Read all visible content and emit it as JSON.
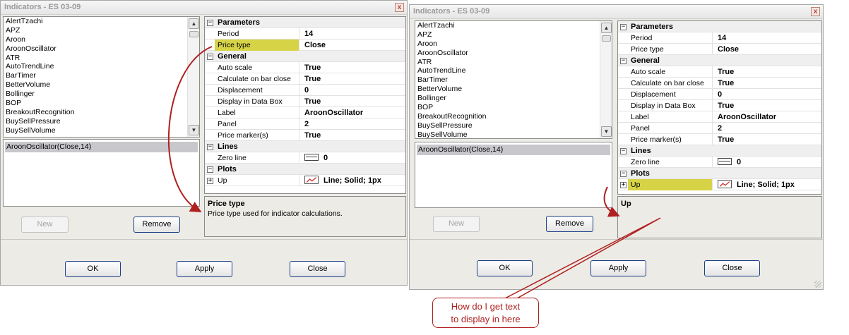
{
  "left": {
    "title": "Indicators - ES 03-09",
    "close_glyph": "x",
    "indicator_list": [
      "AlertTzachi",
      "APZ",
      "Aroon",
      "AroonOscillator",
      "ATR",
      "AutoTrendLine",
      "BarTimer",
      "BetterVolume",
      "Bollinger",
      "BOP",
      "BreakoutRecognition",
      "BuySellPressure",
      "BuySellVolume"
    ],
    "applied": "AroonOscillator(Close,14)",
    "buttons": {
      "new": "New",
      "remove": "Remove",
      "ok": "OK",
      "apply": "Apply",
      "close": "Close"
    },
    "grid": {
      "parameters": {
        "label": "Parameters",
        "period_name": "Period",
        "period_val": "14",
        "price_type_name": "Price type",
        "price_type_val": "Close"
      },
      "general": {
        "label": "General",
        "auto_scale_name": "Auto scale",
        "auto_scale_val": "True",
        "calc_name": "Calculate on bar close",
        "calc_val": "True",
        "displacement_name": "Displacement",
        "displacement_val": "0",
        "databox_name": "Display in Data Box",
        "databox_val": "True",
        "label_name": "Label",
        "label_val": "AroonOscillator",
        "panel_name": "Panel",
        "panel_val": "2",
        "marker_name": "Price marker(s)",
        "marker_val": "True"
      },
      "lines": {
        "label": "Lines",
        "zero_name": "Zero line",
        "zero_val": "0"
      },
      "plots": {
        "label": "Plots",
        "up_name": "Up",
        "up_val": "Line; Solid; 1px"
      }
    },
    "description": {
      "title": "Price type",
      "text": "Price type used for indicator calculations."
    }
  },
  "right": {
    "title": "Indicators - ES 03-09",
    "close_glyph": "x",
    "indicator_list": [
      "AlertTzachi",
      "APZ",
      "Aroon",
      "AroonOscillator",
      "ATR",
      "AutoTrendLine",
      "BarTimer",
      "BetterVolume",
      "Bollinger",
      "BOP",
      "BreakoutRecognition",
      "BuySellPressure",
      "BuySellVolume"
    ],
    "applied": "AroonOscillator(Close,14)",
    "buttons": {
      "new": "New",
      "remove": "Remove",
      "ok": "OK",
      "apply": "Apply",
      "close": "Close"
    },
    "grid": {
      "parameters": {
        "label": "Parameters",
        "period_name": "Period",
        "period_val": "14",
        "price_type_name": "Price type",
        "price_type_val": "Close"
      },
      "general": {
        "label": "General",
        "auto_scale_name": "Auto scale",
        "auto_scale_val": "True",
        "calc_name": "Calculate on bar close",
        "calc_val": "True",
        "displacement_name": "Displacement",
        "displacement_val": "0",
        "databox_name": "Display in Data Box",
        "databox_val": "True",
        "label_name": "Label",
        "label_val": "AroonOscillator",
        "panel_name": "Panel",
        "panel_val": "2",
        "marker_name": "Price marker(s)",
        "marker_val": "True"
      },
      "lines": {
        "label": "Lines",
        "zero_name": "Zero line",
        "zero_val": "0"
      },
      "plots": {
        "label": "Plots",
        "up_name": "Up",
        "up_val": "Line; Solid; 1px"
      }
    },
    "description": {
      "title": "Up",
      "text": ""
    }
  },
  "callout": {
    "line1": "How do I get text",
    "line2": "to display in here"
  },
  "colors": {
    "highlight": "#d7d347",
    "annotation": "#b02020",
    "plot_line": "#d02020"
  },
  "icons": {
    "expand": "minus-box-icon",
    "collapse": "plus-box-icon",
    "scroll_up": "chevron-up-icon",
    "scroll_down": "chevron-down-icon"
  }
}
